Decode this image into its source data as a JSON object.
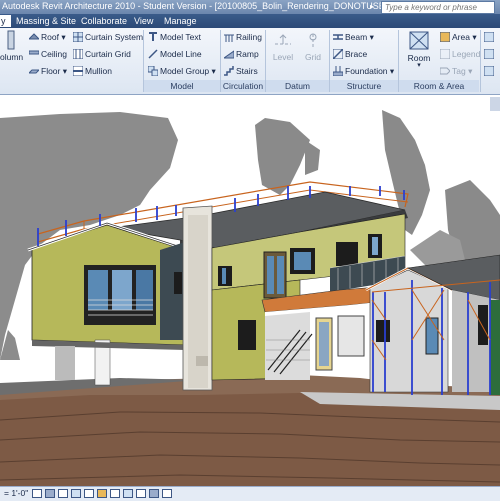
{
  "window": {
    "title": "Autodesk Revit Architecture 2010 - Student Version - [20100805_Bolin_Rendering_DONOTUSE - 3D View:",
    "search_placeholder": "Type a keyword or phrase"
  },
  "tabs": [
    "y",
    "Massing & Site",
    "Collaborate",
    "View",
    "Manage"
  ],
  "ribbon": {
    "build": {
      "column_label": "olumn",
      "roof": "Roof",
      "ceiling": "Ceiling",
      "floor": "Floor",
      "curtain_system": "Curtain System",
      "curtain_grid": "Curtain Grid",
      "mullion": "Mullion"
    },
    "model": {
      "model_text": "Model Text",
      "model_line": "Model Line",
      "model_group": "Model Group",
      "panel_label": "Model"
    },
    "circulation": {
      "railing": "Railing",
      "ramp": "Ramp",
      "stairs": "Stairs",
      "panel_label": "Circulation"
    },
    "datum": {
      "level": "Level",
      "grid": "Grid",
      "panel_label": "Datum"
    },
    "structure": {
      "beam": "Beam",
      "brace": "Brace",
      "foundation": "Foundation",
      "panel_label": "Structure"
    },
    "room_area": {
      "room": "Room",
      "area": "Area",
      "legend": "Legend",
      "tag": "Tag",
      "panel_label": "Room & Area"
    }
  },
  "statusbar": {
    "scale": "= 1'-0\""
  },
  "colors": {
    "titlebar": "#6b86ad",
    "tabs": "#2c4a77",
    "ribbon": "#dde6f2",
    "wall_green": "#b6b85a",
    "wall_dark": "#3d4a52",
    "roof": "#5a5d60"
  }
}
